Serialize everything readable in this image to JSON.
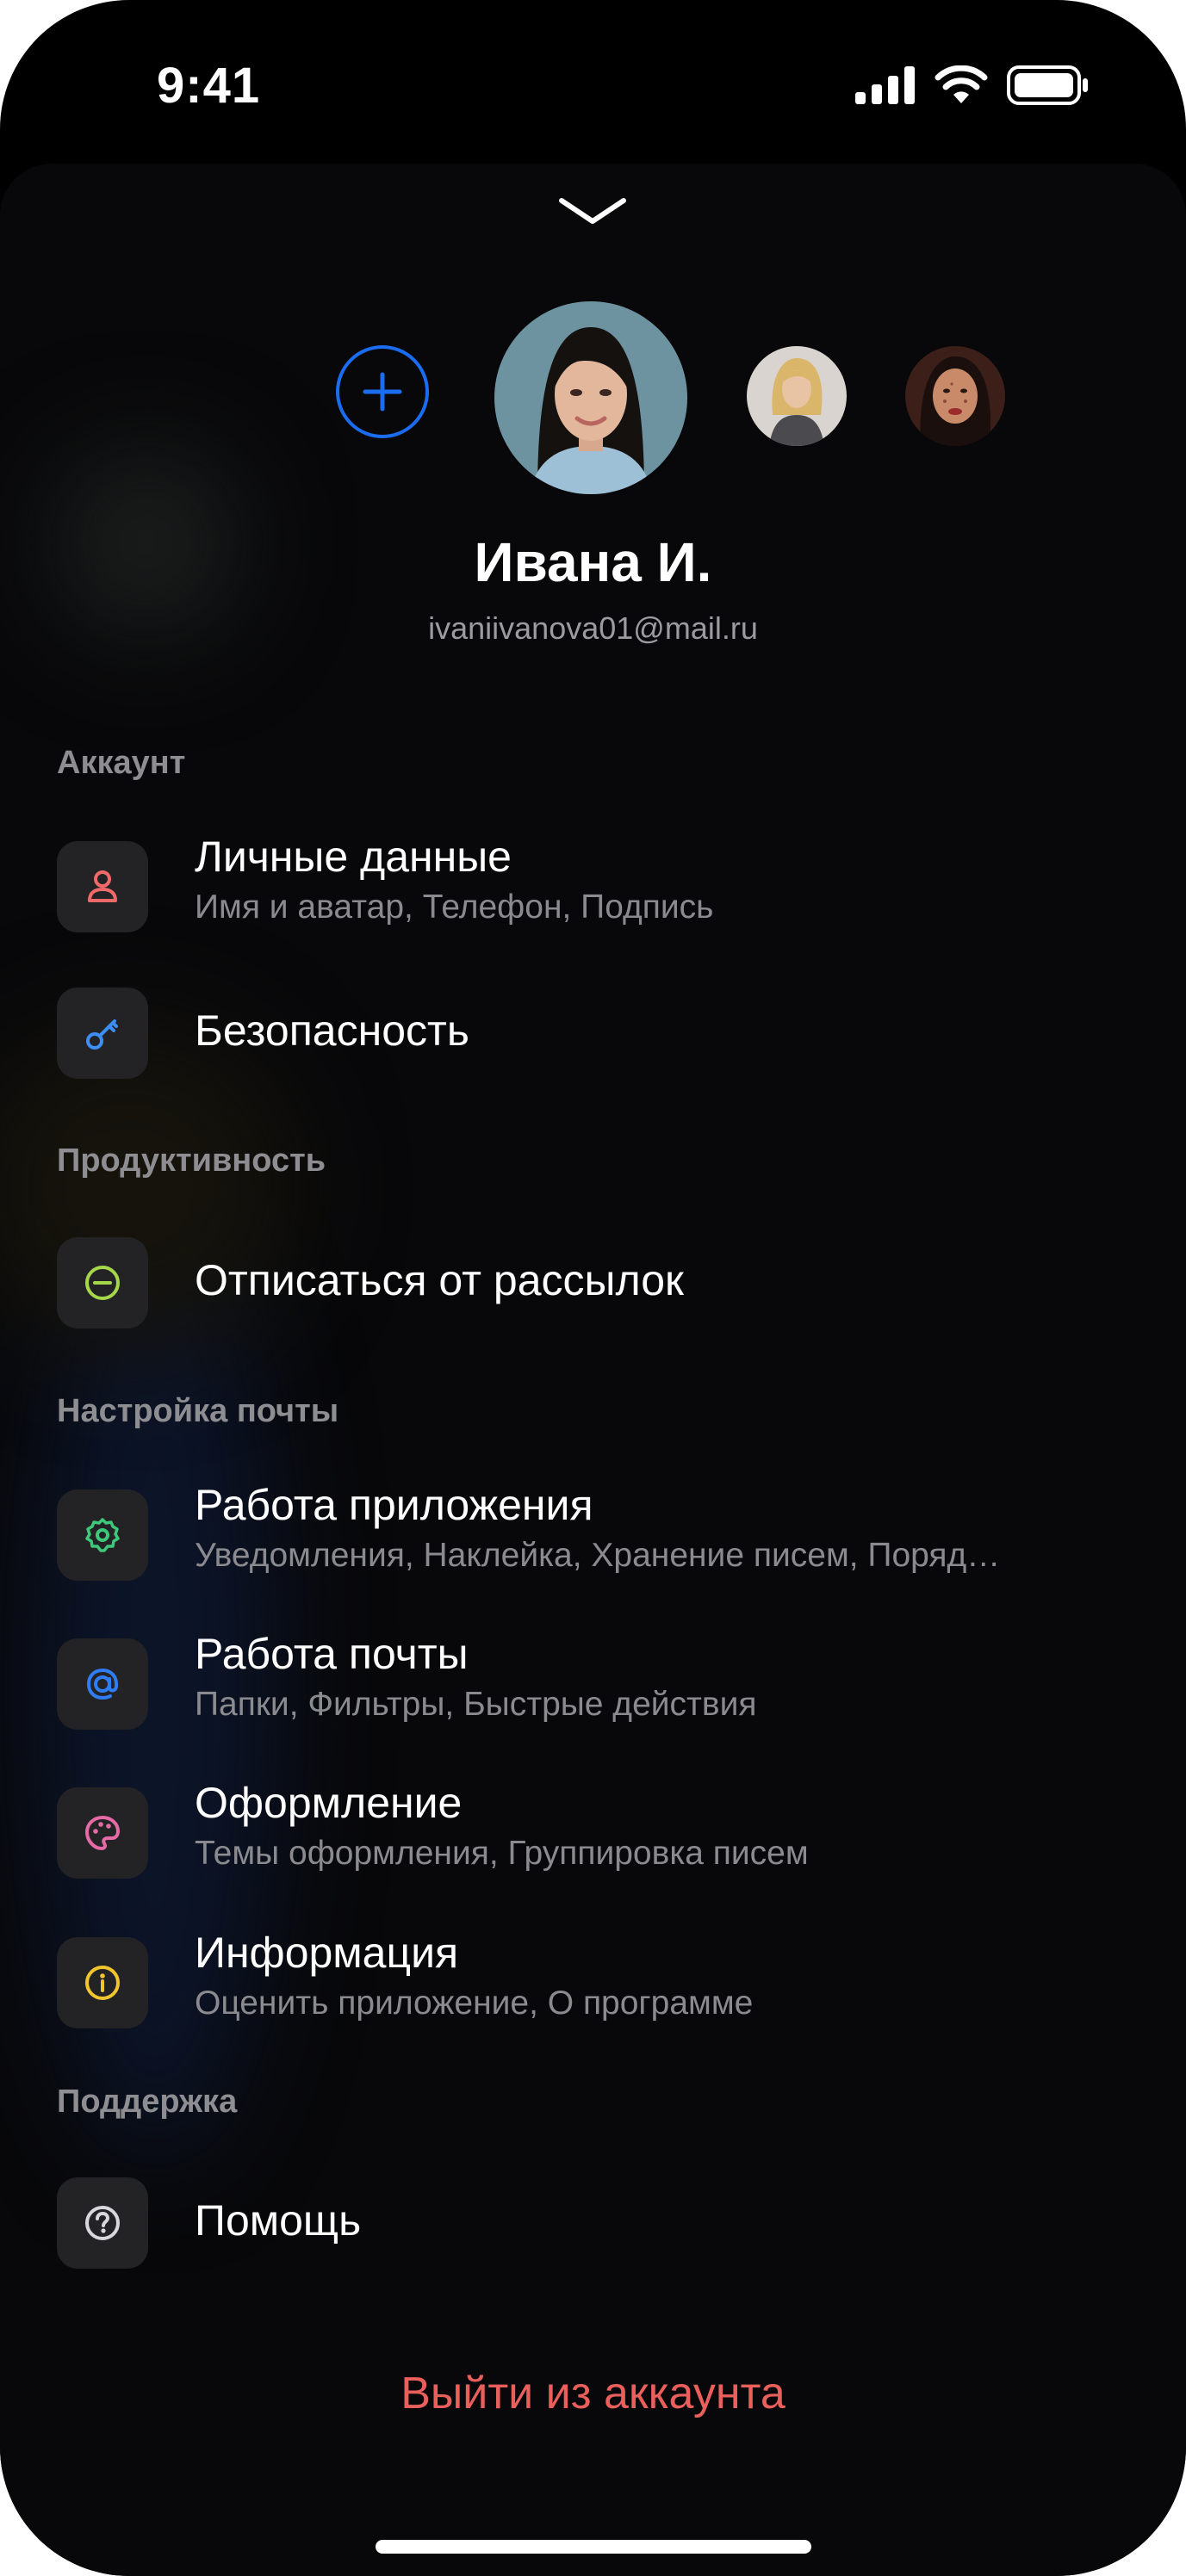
{
  "status_bar": {
    "time": "9:41"
  },
  "profile": {
    "name": "Ивана И.",
    "email": "ivaniivanova01@mail.ru"
  },
  "sections": {
    "account": {
      "title": "Аккаунт",
      "items": [
        {
          "title": "Личные данные",
          "subtitle": "Имя и аватар, Телефон, Подпись",
          "icon": "person-icon",
          "color": "#f06a6a"
        },
        {
          "title": "Безопасность",
          "icon": "key-icon",
          "color": "#3d8ef5"
        }
      ]
    },
    "productivity": {
      "title": "Продуктивность",
      "items": [
        {
          "title": "Отписаться от рассылок",
          "icon": "minus-circle-icon",
          "color": "#a6d64a"
        }
      ]
    },
    "mail_settings": {
      "title": "Настройка почты",
      "items": [
        {
          "title": "Работа приложения",
          "subtitle": "Уведомления, Наклейка, Хранение писем, Поряд…",
          "icon": "gear-icon",
          "color": "#3fc77a"
        },
        {
          "title": "Работа почты",
          "subtitle": "Папки, Фильтры, Быстрые действия",
          "icon": "at-sign-icon",
          "color": "#2f7df2"
        },
        {
          "title": "Оформление",
          "subtitle": "Темы оформления, Группировка писем",
          "icon": "palette-icon",
          "color": "#e66aa6"
        },
        {
          "title": "Информация",
          "subtitle": "Оценить приложение, О программе",
          "icon": "info-icon",
          "color": "#f0c52e"
        }
      ]
    },
    "support": {
      "title": "Поддержка",
      "items": [
        {
          "title": "Помощь",
          "icon": "question-icon",
          "color": "#d8d8dc"
        }
      ]
    }
  },
  "logout_label": "Выйти из аккаунта",
  "colors": {
    "accent_blue": "#1a6cf0",
    "logout_red": "#e85f5c",
    "background": "#08080a"
  }
}
